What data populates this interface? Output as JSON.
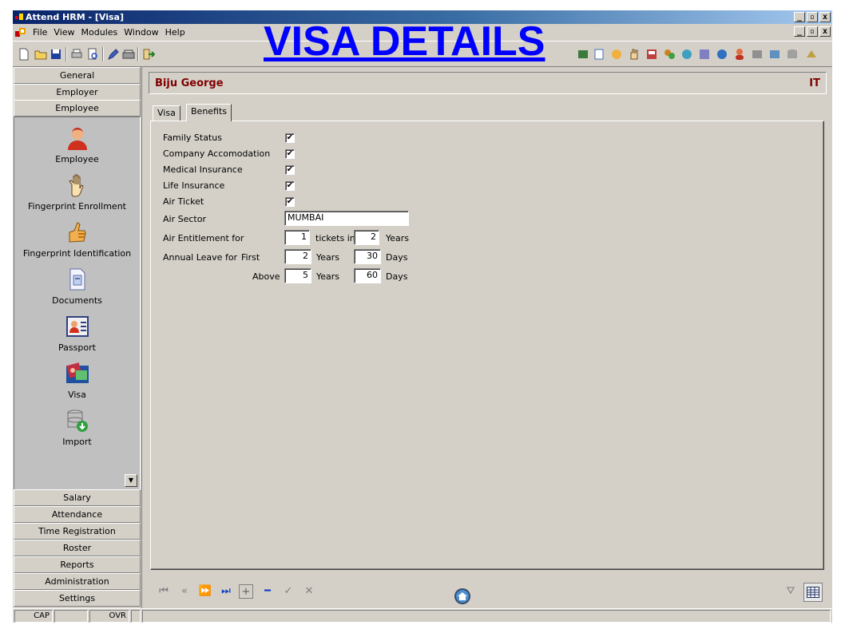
{
  "window": {
    "title": "Attend HRM - [Visa]",
    "controls": [
      "_",
      "▫",
      "x"
    ]
  },
  "overlay_title": "VISA DETAILS",
  "menu": {
    "items": [
      "File",
      "View",
      "Modules",
      "Window",
      "Help"
    ]
  },
  "sidebar": {
    "top_buttons": [
      "General",
      "Employer",
      "Employee"
    ],
    "items": [
      {
        "label": "Employee",
        "icon": "employee-icon"
      },
      {
        "label": "Fingerprint Enrollment",
        "icon": "hand-icon"
      },
      {
        "label": "Fingerprint Identification",
        "icon": "thumb-icon"
      },
      {
        "label": "Documents",
        "icon": "documents-icon"
      },
      {
        "label": "Passport",
        "icon": "passport-icon"
      },
      {
        "label": "Visa",
        "icon": "visa-icon"
      },
      {
        "label": "Import",
        "icon": "import-icon"
      }
    ],
    "bottom_buttons": [
      "Salary",
      "Attendance",
      "Time Registration",
      "Roster",
      "Reports",
      "Administration",
      "Settings"
    ]
  },
  "header": {
    "employee_name": "Biju George",
    "department": "IT"
  },
  "tabs": [
    {
      "label": "Visa",
      "active": false
    },
    {
      "label": "Benefits",
      "active": true
    }
  ],
  "benefits": {
    "family_status": {
      "label": "Family Status",
      "checked": "✔"
    },
    "company_accomodation": {
      "label": "Company Accomodation",
      "checked": "✔"
    },
    "medical_insurance": {
      "label": "Medical Insurance",
      "checked": "✔"
    },
    "life_insurance": {
      "label": "Life Insurance",
      "checked": "✔"
    },
    "air_ticket": {
      "label": "Air Ticket",
      "checked": "✔"
    },
    "air_sector": {
      "label": "Air Sector",
      "value": "MUMBAI"
    },
    "air_entitlement": {
      "label": "Air Entitlement for",
      "tickets": "1",
      "tickets_label": "tickets in",
      "years": "2",
      "years_label": "Years"
    },
    "annual_leave": {
      "label": "Annual Leave for",
      "first_label": "First",
      "first_years": "2",
      "first_years_label": "Years",
      "first_days": "30",
      "first_days_label": "Days",
      "above_label": "Above",
      "above_years": "5",
      "above_years_label": "Years",
      "above_days": "60",
      "above_days_label": "Days"
    }
  },
  "statusbar": {
    "cap": "CAP",
    "ovr": "OVR"
  }
}
